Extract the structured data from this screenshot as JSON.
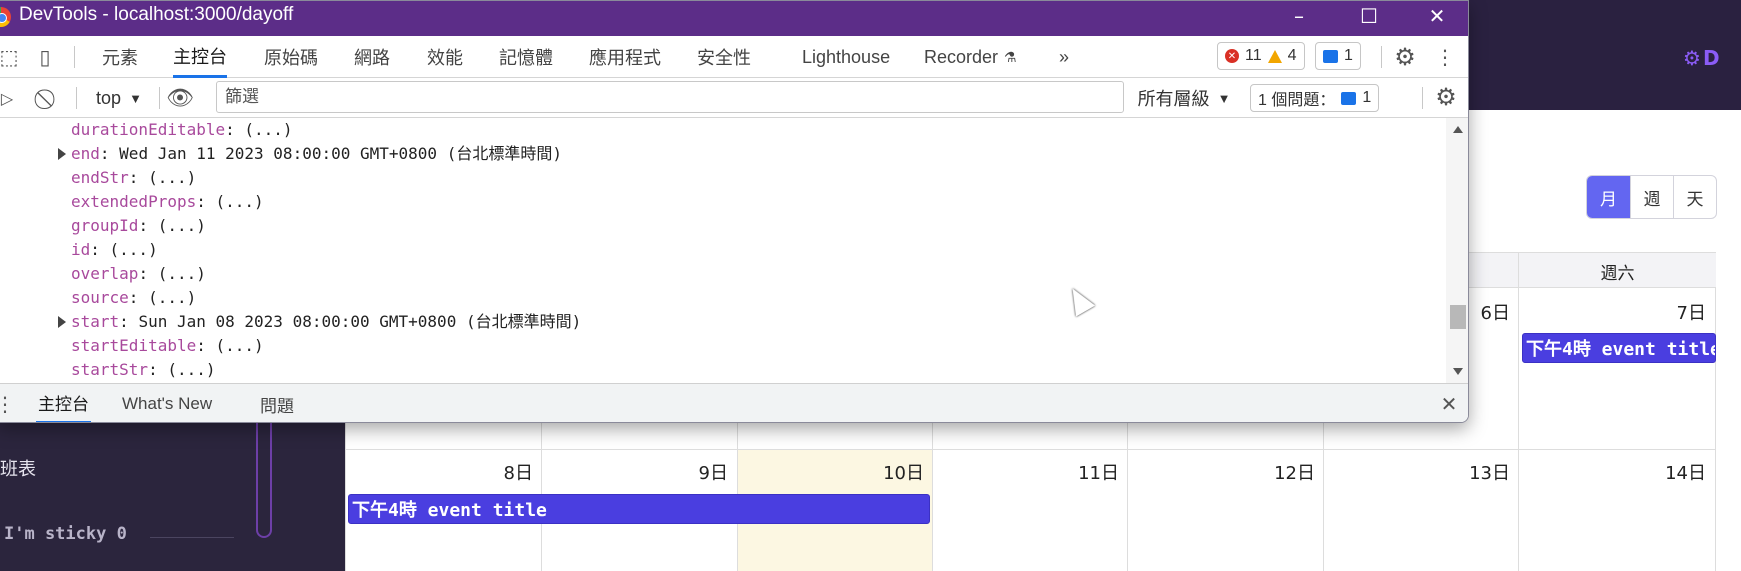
{
  "devtools": {
    "title": "DevTools - localhost:3000/dayoff",
    "tabs": [
      "元素",
      "主控台",
      "原始碼",
      "網路",
      "效能",
      "記憶體",
      "應用程式",
      "安全性",
      "Lighthouse",
      "Recorder"
    ],
    "more_tabs": "»",
    "errors": "11",
    "warnings": "4",
    "messages": "1",
    "context": "top",
    "filter_placeholder": "篩選",
    "levels": "所有層級",
    "issues_label": "1 個問題：",
    "issues_count": "1",
    "console_lines": [
      {
        "prop": "durationEditable",
        "value": ": (...)",
        "expandable": false
      },
      {
        "prop": "end",
        "value": ": Wed Jan 11 2023 08:00:00 GMT+0800 (台北標準時間)",
        "expandable": true
      },
      {
        "prop": "endStr",
        "value": ": (...)",
        "expandable": false
      },
      {
        "prop": "extendedProps",
        "value": ": (...)",
        "expandable": false
      },
      {
        "prop": "groupId",
        "value": ": (...)",
        "expandable": false
      },
      {
        "prop": "id",
        "value": ": (...)",
        "expandable": false
      },
      {
        "prop": "overlap",
        "value": ": (...)",
        "expandable": false
      },
      {
        "prop": "source",
        "value": ": (...)",
        "expandable": false
      },
      {
        "prop": "start",
        "value": ": Sun Jan 08 2023 08:00:00 GMT+0800 (台北標準時間)",
        "expandable": true
      },
      {
        "prop": "startEditable",
        "value": ": (...)",
        "expandable": false
      },
      {
        "prop": "startStr",
        "value": ": (...)",
        "expandable": false
      }
    ],
    "drawer_tabs": [
      "主控台",
      "What's New",
      "問題"
    ],
    "close": "✕"
  },
  "app": {
    "logo_letter": "D",
    "sidebar_item": "班表",
    "sticky_text": "I'm sticky 0",
    "views": [
      "月",
      "週",
      "天"
    ],
    "active_view": "月",
    "weekday_header": "週六",
    "week1_days": {
      "d6": "6日",
      "d7": "7日"
    },
    "week2_days": [
      "8日",
      "9日",
      "10日",
      "11日",
      "12日",
      "13日",
      "14日"
    ],
    "event_title": "下午4時 event title",
    "colors": {
      "event": "#4a3ee0",
      "today": "#fcf7e2",
      "view_active": "#6366f1",
      "titlebar": "#5c2d88"
    }
  }
}
